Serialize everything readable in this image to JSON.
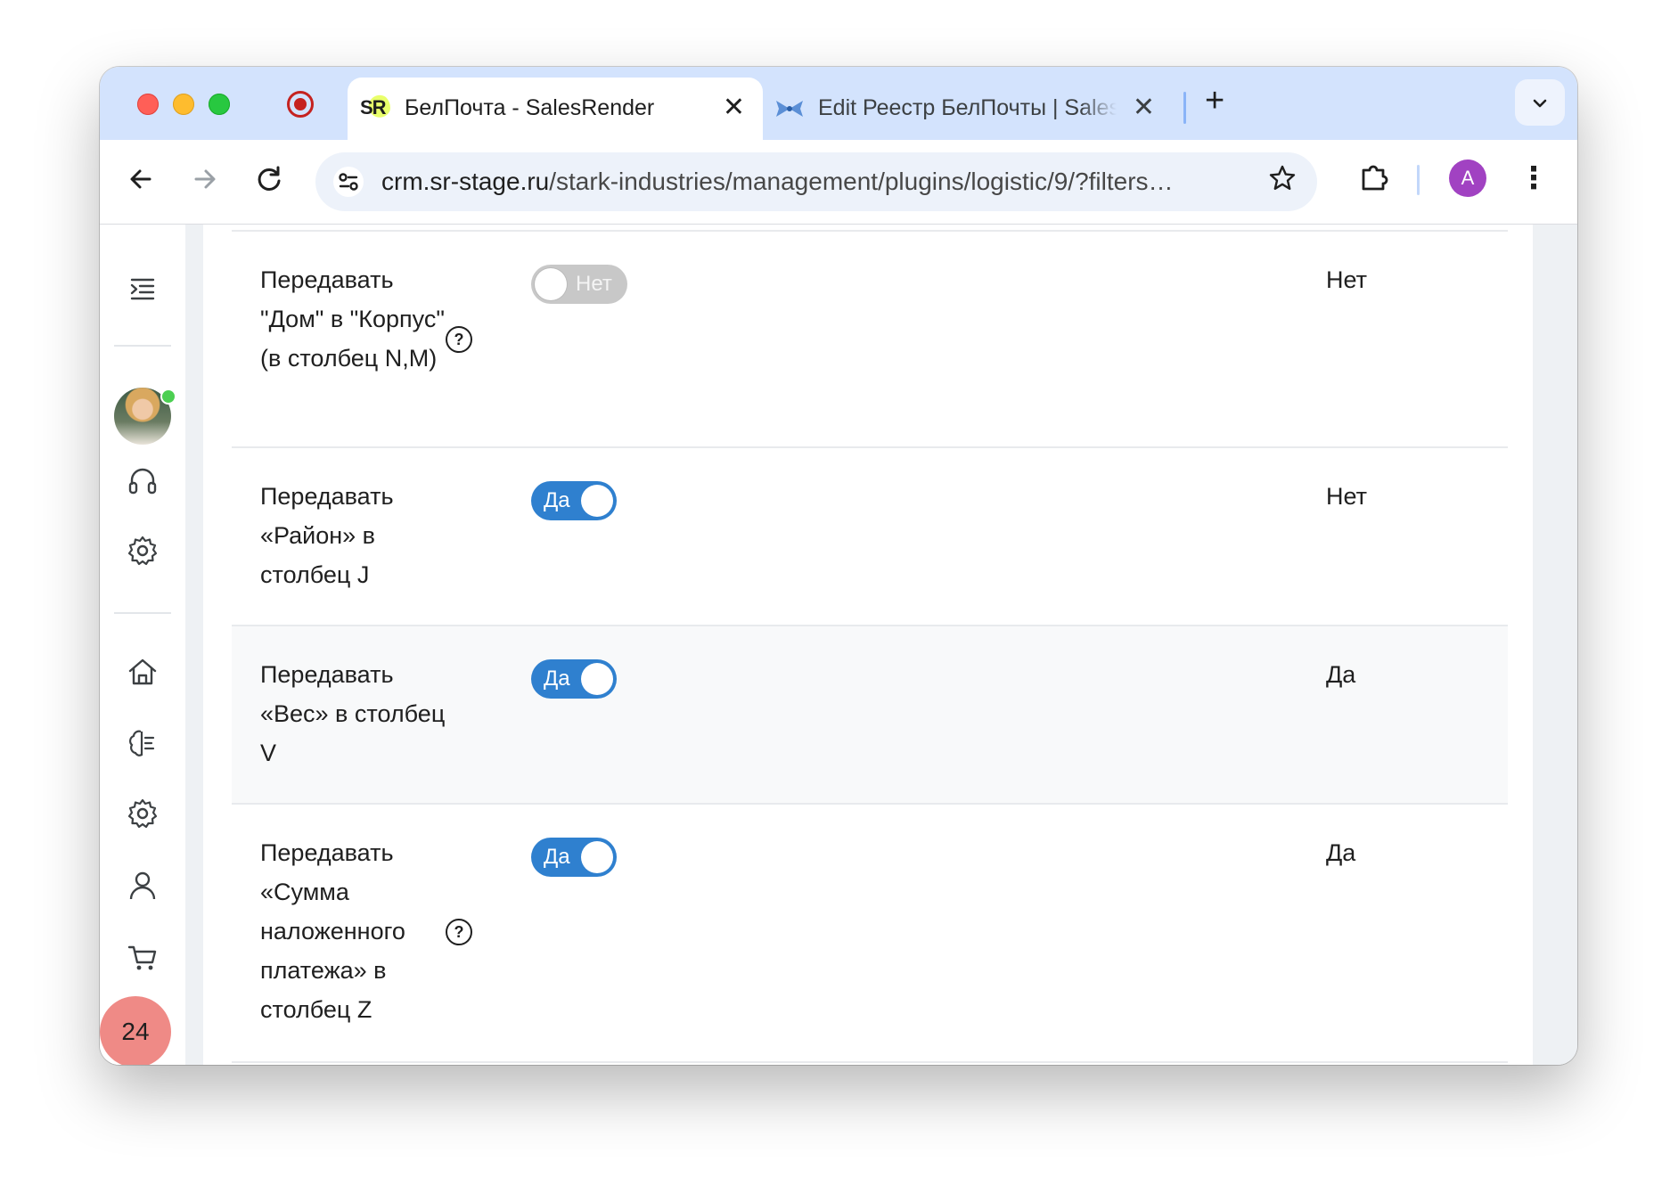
{
  "browser": {
    "tabs": [
      {
        "title": "БелПочта - SalesRender",
        "favicon": "SR",
        "active": true
      },
      {
        "title": "Edit Реестр БелПочты | SalesRender",
        "favicon": "bow-icon",
        "active": false
      }
    ],
    "new_tab_symbol": "+",
    "tab_search_symbol": "⌄",
    "close_symbol": "✕",
    "url_host": "crm.sr-stage.ru",
    "url_path": "/stark-industries/management/plugins/logistic/9/?filters…",
    "profile_initial": "A",
    "star_symbol": "☆",
    "menu_symbol": "⋮"
  },
  "sidebar": {
    "notifications_count": "24",
    "icons": [
      "menu-toggle-icon",
      "avatar",
      "headset-icon",
      "settings-icon",
      "home-icon",
      "brain-icon",
      "settings-icon",
      "user-icon",
      "cart-icon"
    ]
  },
  "settings": {
    "rows": [
      {
        "label": "Передавать \"Дом\" в \"Корпус\" (в столбец N,M)",
        "toggle": "Нет",
        "enabled": false,
        "value": "Нет",
        "help": true
      },
      {
        "label": "Передавать «Район» в столбец J",
        "toggle": "Да",
        "enabled": true,
        "value": "Нет",
        "help": false
      },
      {
        "label": "Передавать «Вес» в столбец V",
        "toggle": "Да",
        "enabled": true,
        "value": "Да",
        "help": false
      },
      {
        "label": "Передавать «Сумма наложенного платежа» в столбец Z",
        "toggle": "Да",
        "enabled": true,
        "value": "Да",
        "help": true
      }
    ],
    "help_symbol": "?"
  },
  "colors": {
    "tabstrip": "#d3e3fd",
    "toggle_on": "#2f80cf",
    "toggle_off": "#c8c8c8",
    "badge": "#ef8a86",
    "profile": "#a142c2"
  }
}
